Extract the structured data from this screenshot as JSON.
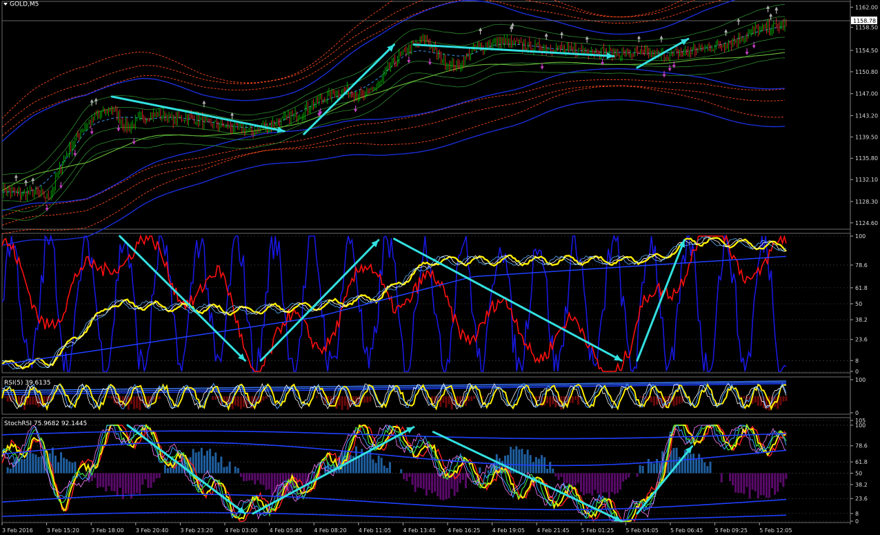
{
  "window": {
    "symbol_label": "GOLD,M5",
    "current_price": "1158.78"
  },
  "colors": {
    "background": "#000000",
    "grid": "#3a3a3a",
    "axis_text": "#dddddd",
    "candle_up": "#00cc00",
    "candle_down": "#ff3030",
    "band_red": "#ff4a1c",
    "band_green": "#2e8b2e",
    "band_blue": "#1a2ed8",
    "trend_arrow": "#33e0e0",
    "stoch_red": "#ff1010",
    "stoch_blue": "#1818e0",
    "yellow": "#ffee00",
    "rsi_hist": "#6b0a0a",
    "stochrsi_hist_pos": "#1f5fa0",
    "stochrsi_hist_neg": "#5a0a6a"
  },
  "chart_data": [
    {
      "type": "line",
      "panel": "price",
      "title": "GOLD,M5",
      "ylim": [
        1123.5,
        1163.0
      ],
      "y_ticks": [
        "1162.00",
        "1158.50",
        "1154.50",
        "1150.80",
        "1147.00",
        "1143.20",
        "1139.50",
        "1135.80",
        "1132.10",
        "1128.30",
        "1124.60"
      ],
      "x_labels": [
        "3 Feb 2016",
        "3 Feb 15:20",
        "3 Feb 18:00",
        "3 Feb 20:40",
        "3 Feb 23:20",
        "4 Feb 03:00",
        "4 Feb 05:40",
        "4 Feb 08:20",
        "4 Feb 11:05",
        "4 Feb 13:45",
        "4 Feb 16:25",
        "4 Feb 19:05",
        "4 Feb 21:45",
        "5 Feb 01:25",
        "5 Feb 04:05",
        "5 Feb 06:45",
        "5 Feb 09:25",
        "5 Feb 12:05"
      ],
      "series": [
        {
          "x": [
            0,
            2,
            4,
            6,
            8,
            10,
            12,
            14,
            16,
            18,
            20,
            22,
            24,
            26,
            28,
            30,
            32,
            34,
            36,
            38,
            40,
            42,
            44,
            46,
            48,
            50,
            52,
            54,
            56,
            58,
            60,
            62,
            64,
            66,
            68,
            70,
            72,
            74,
            76,
            78,
            80,
            82,
            84,
            86,
            88,
            90,
            92,
            94,
            96,
            98,
            100
          ],
          "values": [
            1130.5,
            1129.5,
            1130.0,
            1129.0,
            1136.0,
            1140.5,
            1143.0,
            1144.5,
            1141.0,
            1143.0,
            1143.5,
            1142.5,
            1143.0,
            1142.0,
            1141.5,
            1141.0,
            1140.5,
            1141.5,
            1142.5,
            1143.5,
            1145.5,
            1147.0,
            1147.5,
            1146.5,
            1148.5,
            1152.5,
            1155.0,
            1156.5,
            1153.0,
            1151.5,
            1154.5,
            1155.5,
            1156.0,
            1155.5,
            1155.0,
            1155.0,
            1154.5,
            1154.5,
            1154.5,
            1154.0,
            1154.0,
            1154.0,
            1153.5,
            1154.0,
            1154.5,
            1155.0,
            1155.5,
            1156.5,
            1158.0,
            1158.5,
            1158.8
          ]
        }
      ],
      "trend_arrows": [
        {
          "from": [
            14,
            1146.5
          ],
          "to": [
            36,
            1140.5
          ]
        },
        {
          "from": [
            38.5,
            1140.0
          ],
          "to": [
            50,
            1155.5
          ]
        },
        {
          "from": [
            52.5,
            1155.5
          ],
          "to": [
            78,
            1153.5
          ]
        },
        {
          "from": [
            81,
            1151.5
          ],
          "to": [
            87.5,
            1156.5
          ]
        }
      ]
    },
    {
      "type": "line",
      "panel": "stochastic",
      "ylim": [
        0,
        100
      ],
      "y_ticks": [
        "100",
        "78.6",
        "61.8",
        "50",
        "38.2",
        "23.6",
        "8",
        "0"
      ],
      "trend_arrows": [
        {
          "from": [
            15,
            100
          ],
          "to": [
            31,
            8
          ]
        },
        {
          "from": [
            33,
            8
          ],
          "to": [
            48,
            97
          ]
        },
        {
          "from": [
            50,
            98
          ],
          "to": [
            79,
            8
          ]
        },
        {
          "from": [
            81,
            8
          ],
          "to": [
            87,
            97
          ]
        }
      ]
    },
    {
      "type": "line",
      "panel": "rsi",
      "title": "RSI(5) 39.6135",
      "ylim": [
        0,
        100
      ],
      "y_ticks": [
        "100",
        "0"
      ]
    },
    {
      "type": "line",
      "panel": "stochrsi",
      "title": "StochRSI 75.9682 92.1445",
      "ylim": [
        0,
        105
      ],
      "y_ticks": [
        "105",
        "100",
        "78.6",
        "61.8",
        "50",
        "38.2",
        "23.6",
        "8",
        "0"
      ],
      "trend_arrows": [
        {
          "from": [
            16,
            100
          ],
          "to": [
            31,
            8
          ]
        },
        {
          "from": [
            32,
            8
          ],
          "to": [
            52.5,
            98
          ]
        },
        {
          "from": [
            55,
            93
          ],
          "to": [
            79,
            0
          ]
        },
        {
          "from": [
            81,
            8
          ],
          "to": [
            88,
            78
          ]
        }
      ]
    }
  ]
}
